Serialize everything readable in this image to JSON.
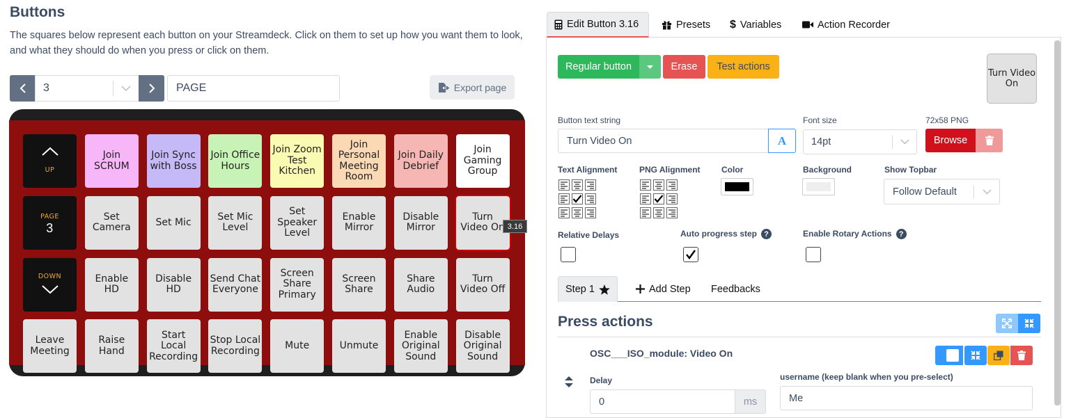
{
  "header": {
    "title": "Buttons",
    "description": "The squares below represent each button on your Streamdeck. Click on them to set up how you want them to look, and what they should do when you press or click on them."
  },
  "pager": {
    "page_number": "3",
    "page_name": "PAGE",
    "export_label": "Export page"
  },
  "deck": {
    "rows": [
      [
        {
          "type": "nav",
          "label": "UP",
          "icon": "chevron-up-icon"
        },
        {
          "text": "Join SCRUM",
          "bg": "#f7b6f7"
        },
        {
          "text": "Join Sync with Boss",
          "bg": "#c6b9f7"
        },
        {
          "text": "Join Office Hours",
          "bg": "#c7f4b6"
        },
        {
          "text": "Join Zoom Test Kitchen",
          "bg": "#fbfab3"
        },
        {
          "text": "Join Personal Meeting Room",
          "bg": "#fad9b4"
        },
        {
          "text": "Join Daily Debrief",
          "bg": "#f6b7b4"
        },
        {
          "text": "Join Gaming Group",
          "bg": "#ffffff"
        }
      ],
      [
        {
          "type": "nav",
          "label": "PAGE",
          "number": "3"
        },
        {
          "text": "Set Camera"
        },
        {
          "text": "Set Mic"
        },
        {
          "text": "Set Mic Level"
        },
        {
          "text": "Set Speaker Level"
        },
        {
          "text": "Enable Mirror"
        },
        {
          "text": "Disable Mirror"
        },
        {
          "text": "Turn Video On",
          "selected": true
        }
      ],
      [
        {
          "type": "nav",
          "label": "DOWN",
          "icon": "chevron-down-icon"
        },
        {
          "text": "Enable HD"
        },
        {
          "text": "Disable HD"
        },
        {
          "text": "Send Chat Everyone"
        },
        {
          "text": "Screen Share Primary"
        },
        {
          "text": "Screen Share"
        },
        {
          "text": "Share Audio"
        },
        {
          "text": "Turn Video Off"
        }
      ],
      [
        {
          "text": "Leave Meeting"
        },
        {
          "text": "Raise Hand"
        },
        {
          "text": "Start Local Recording"
        },
        {
          "text": "Stop Local Recording"
        },
        {
          "text": "Mute"
        },
        {
          "text": "Unmute"
        },
        {
          "text": "Enable Original Sound"
        },
        {
          "text": "Disable Original Sound"
        }
      ]
    ],
    "tooltip": "3.16"
  },
  "tabs": {
    "edit": "Edit Button 3.16",
    "presets": "Presets",
    "variables": "Variables",
    "recorder": "Action Recorder"
  },
  "editor": {
    "regular_button": "Regular button",
    "erase": "Erase",
    "test_actions": "Test actions",
    "preview_text": "Turn Video On",
    "button_text_label": "Button text string",
    "button_text_value": "Turn Video On",
    "font_size_label": "Font size",
    "font_size_value": "14pt",
    "png_label": "72x58 PNG",
    "browse": "Browse",
    "text_alignment_label": "Text Alignment",
    "png_alignment_label": "PNG Alignment",
    "color_label": "Color",
    "background_label": "Background",
    "show_topbar_label": "Show Topbar",
    "show_topbar_value": "Follow Default",
    "relative_delays_label": "Relative Delays",
    "auto_progress_label": "Auto progress step",
    "rotary_label": "Enable Rotary Actions",
    "help_glyph": "?",
    "colors": {
      "text": "#000000",
      "background": "#eeeeee"
    }
  },
  "steps": {
    "step1": "Step 1",
    "add_step": "Add Step",
    "feedbacks": "Feedbacks"
  },
  "actions": {
    "title": "Press actions",
    "action_name": "OSC___ISO_module: Video On",
    "delay_label": "Delay",
    "delay_value": "0",
    "delay_unit": "ms",
    "username_label": "username (keep blank when you pre-select)",
    "username_value": "Me"
  }
}
